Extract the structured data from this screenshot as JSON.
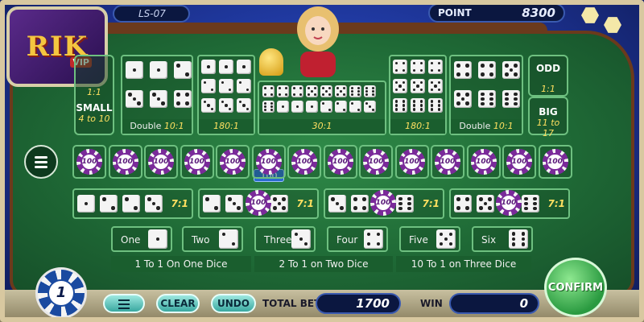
{
  "header": {
    "room_id": "LS-07",
    "point_label": "POINT",
    "point_value": "8300"
  },
  "logo": {
    "text": "RIK",
    "sub": "VIP"
  },
  "bets": {
    "small": {
      "label": "SMALL",
      "odds_top": "1:1",
      "odds": "4 to 10"
    },
    "big": {
      "label": "BIG",
      "odds_top": "1:1",
      "odds": "11 to 17"
    },
    "odd": {
      "label": "ODD",
      "odds": "1:1"
    },
    "double_left": {
      "label": "Double",
      "odds": "10:1"
    },
    "double_right": {
      "label": "Double",
      "odds": "10:1"
    },
    "triple_left": {
      "odds": "180:1"
    },
    "triple_right": {
      "odds": "180:1"
    },
    "any_triple": {
      "odds": "30:1"
    },
    "pair_odds": "7:1"
  },
  "chips": {
    "value": "100",
    "tag": "100",
    "count": 14,
    "selected": "1"
  },
  "singles": {
    "items": [
      {
        "label": "One",
        "pips": 1
      },
      {
        "label": "Two",
        "pips": 2
      },
      {
        "label": "Three",
        "pips": 3
      },
      {
        "label": "Four",
        "pips": 4
      },
      {
        "label": "Five",
        "pips": 5
      },
      {
        "label": "Six",
        "pips": 6
      }
    ],
    "bar_left": "1 To 1 On One Dice",
    "bar_mid": "2 To 1 on Two Dice",
    "bar_right": "10 To 1 on Three Dice"
  },
  "controls": {
    "clear": "CLEAR",
    "undo": "UNDO",
    "total_bet_label": "TOTAL BET",
    "total_bet": "1700",
    "win_label": "WIN",
    "win": "0",
    "confirm": "CONFIRM"
  },
  "colors": {
    "felt": "#1f6a36",
    "chip_purple": "#7a2a9a",
    "accent_gold": "#ffe060"
  }
}
